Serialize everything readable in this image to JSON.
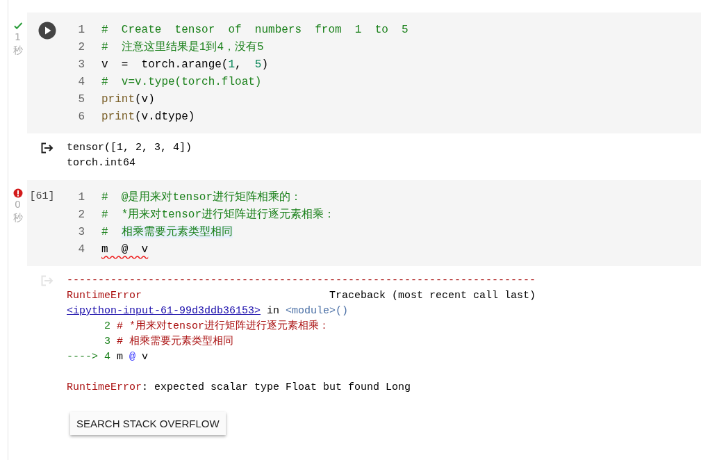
{
  "cells": [
    {
      "error": false,
      "duration": "1",
      "unit": "秒",
      "gutter": {
        "kind": "run-button"
      },
      "lines": [
        {
          "number": "1",
          "tokens": [
            {
              "kind": "comment",
              "text": "#  Create  tensor  of  numbers  from  1  to  5"
            }
          ]
        },
        {
          "number": "2",
          "tokens": [
            {
              "kind": "comment",
              "text": "#  注意这里结果是1到4，没有5"
            }
          ]
        },
        {
          "number": "3",
          "tokens": [
            {
              "kind": "plain",
              "text": "v  =  torch.arange("
            },
            {
              "kind": "number",
              "text": "1"
            },
            {
              "kind": "plain",
              "text": ",  "
            },
            {
              "kind": "number",
              "text": "5"
            },
            {
              "kind": "plain",
              "text": ")"
            }
          ]
        },
        {
          "number": "4",
          "tokens": [
            {
              "kind": "comment",
              "text": "#  v=v.type(torch.float)"
            }
          ]
        },
        {
          "number": "5",
          "tokens": [
            {
              "kind": "builtin",
              "text": "print"
            },
            {
              "kind": "plain",
              "text": "(v)"
            }
          ]
        },
        {
          "number": "6",
          "tokens": [
            {
              "kind": "builtin",
              "text": "print"
            },
            {
              "kind": "plain",
              "text": "(v.dtype)"
            }
          ]
        }
      ],
      "output": {
        "dimmed": false,
        "lines": [
          {
            "tokens": [
              {
                "kind": "plain",
                "text": "tensor([1, 2, 3, 4])"
              }
            ]
          },
          {
            "tokens": [
              {
                "kind": "plain",
                "text": "torch.int64"
              }
            ]
          }
        ]
      }
    },
    {
      "error": true,
      "duration": "0",
      "unit": "秒",
      "gutter": {
        "kind": "count",
        "text": "[61]"
      },
      "lines": [
        {
          "number": "1",
          "tokens": [
            {
              "kind": "comment",
              "text": "#  @是用来对tensor进行矩阵相乘的："
            }
          ]
        },
        {
          "number": "2",
          "tokens": [
            {
              "kind": "comment",
              "text": "#  *用来对tensor进行矩阵进行逐元素相乘："
            }
          ]
        },
        {
          "number": "3",
          "tokens": [
            {
              "kind": "comment",
              "text": "#  "
            },
            {
              "kind": "comment",
              "text": "相乘需要元素类型相同",
              "highlighted": true
            }
          ]
        },
        {
          "number": "4",
          "tokens": [
            {
              "kind": "plain",
              "text": "m  @  v",
              "squiggle": true
            }
          ]
        }
      ],
      "output": {
        "dimmed": true,
        "lines": [
          {
            "tokens": [
              {
                "kind": "error",
                "text": "---------------------------------------------------------------------------"
              }
            ]
          },
          {
            "tokens": [
              {
                "kind": "error",
                "text": "RuntimeError                              "
              },
              {
                "kind": "plain",
                "text": "Traceback (most recent call last)"
              }
            ]
          },
          {
            "tokens": [
              {
                "kind": "link",
                "text": "<ipython-input-61-99d3ddb36153>"
              },
              {
                "kind": "plain",
                "text": " in "
              },
              {
                "kind": "module",
                "text": "<module>()"
              }
            ]
          },
          {
            "tokens": [
              {
                "kind": "lineno",
                "text": "      2 "
              },
              {
                "kind": "error",
                "text": "# *用来对tensor进行矩阵进行逐元素相乘："
              }
            ]
          },
          {
            "tokens": [
              {
                "kind": "lineno",
                "text": "      3 "
              },
              {
                "kind": "error",
                "text": "# 相乘需要元素类型相同"
              }
            ]
          },
          {
            "tokens": [
              {
                "kind": "lineno",
                "text": "----> 4 "
              },
              {
                "kind": "plain",
                "text": "m "
              },
              {
                "kind": "operator",
                "text": "@"
              },
              {
                "kind": "plain",
                "text": " v"
              }
            ]
          },
          {
            "kind": "blank"
          },
          {
            "tokens": [
              {
                "kind": "error",
                "text": "RuntimeError"
              },
              {
                "kind": "plain",
                "text": ": expected scalar type Float but found Long"
              }
            ]
          }
        ],
        "button": "SEARCH STACK OVERFLOW"
      }
    }
  ]
}
